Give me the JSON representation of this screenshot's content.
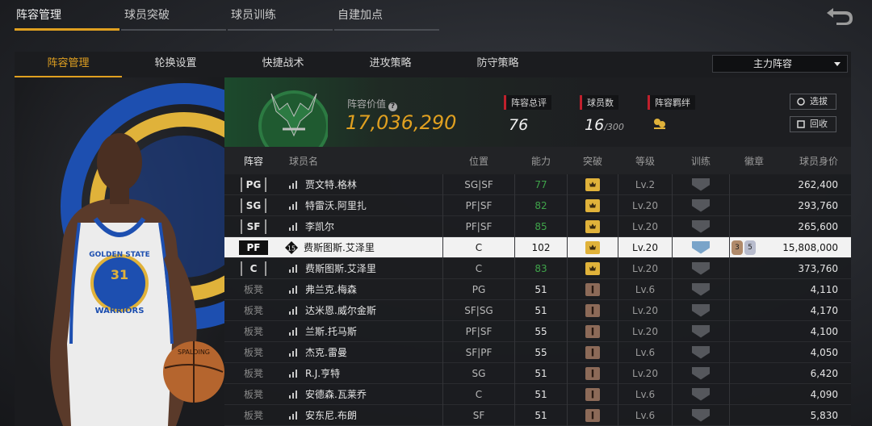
{
  "top_tabs": [
    {
      "label": "阵容管理",
      "active": true
    },
    {
      "label": "球员突破",
      "active": false
    },
    {
      "label": "球员训练",
      "active": false
    },
    {
      "label": "自建加点",
      "active": false
    }
  ],
  "sub_tabs": [
    {
      "label": "阵容管理",
      "active": true
    },
    {
      "label": "轮换设置",
      "active": false
    },
    {
      "label": "快捷战术",
      "active": false
    },
    {
      "label": "进攻策略",
      "active": false
    },
    {
      "label": "防守策略",
      "active": false
    }
  ],
  "lineup_select": {
    "value": "主力阵容"
  },
  "info": {
    "value_label": "阵容价值",
    "value": "17,036,290",
    "rating_label": "阵容总评",
    "rating": "76",
    "players_label": "球员数",
    "players": "16",
    "players_max": "/300",
    "bond_label": "阵容羁绊",
    "btn_draft": "选拔",
    "btn_recycle": "回收"
  },
  "player_art": {
    "jersey_team": "GOLDEN STATE",
    "jersey_number": "31",
    "jersey_name": "WARRIORS",
    "ball_brand": "SPALDING"
  },
  "team_logo_text": "MILWAUKEE BUCKS",
  "columns": [
    "阵容",
    "球员名",
    "位置",
    "能力",
    "突破",
    "等级",
    "训练",
    "徽章",
    "球员身价"
  ],
  "rows": [
    {
      "slot": "PG",
      "name": "贾文特.格林",
      "role": "SG|SF",
      "ability": "77",
      "ability_green": true,
      "break": "gold",
      "level": "Lv.2",
      "train": "grey",
      "badges": [],
      "value": "262,400"
    },
    {
      "slot": "SG",
      "name": "特雷沃.阿里扎",
      "role": "PF|SF",
      "ability": "82",
      "ability_green": true,
      "break": "gold",
      "level": "Lv.20",
      "train": "grey",
      "badges": [],
      "value": "293,760"
    },
    {
      "slot": "SF",
      "name": "李凯尔",
      "role": "PF|SF",
      "ability": "85",
      "ability_green": true,
      "break": "gold",
      "level": "Lv.20",
      "train": "grey",
      "badges": [],
      "value": "265,600"
    },
    {
      "slot": "PF",
      "name": "费斯图斯.艾泽里",
      "role": "C",
      "ability": "102",
      "ability_green": false,
      "break": "gold",
      "level": "Lv.20",
      "train": "blue",
      "badges": [
        "3",
        "5"
      ],
      "value": "15,808,000",
      "selected": true,
      "tier": "15"
    },
    {
      "slot": "C",
      "name": "费斯图斯.艾泽里",
      "role": "C",
      "ability": "83",
      "ability_green": true,
      "break": "gold",
      "level": "Lv.20",
      "train": "grey",
      "badges": [],
      "value": "373,760"
    },
    {
      "slot": "板凳",
      "name": "弗兰克.梅森",
      "role": "PG",
      "ability": "51",
      "ability_green": false,
      "break": "brown",
      "level": "Lv.6",
      "train": "grey",
      "badges": [],
      "value": "4,110"
    },
    {
      "slot": "板凳",
      "name": "达米恩.威尔金斯",
      "role": "SF|SG",
      "ability": "51",
      "ability_green": false,
      "break": "brown",
      "level": "Lv.20",
      "train": "grey",
      "badges": [],
      "value": "4,170"
    },
    {
      "slot": "板凳",
      "name": "兰斯.托马斯",
      "role": "PF|SF",
      "ability": "55",
      "ability_green": false,
      "break": "brown",
      "level": "Lv.20",
      "train": "grey",
      "badges": [],
      "value": "4,100"
    },
    {
      "slot": "板凳",
      "name": "杰克.雷曼",
      "role": "SF|PF",
      "ability": "55",
      "ability_green": false,
      "break": "brown",
      "level": "Lv.6",
      "train": "grey",
      "badges": [],
      "value": "4,050"
    },
    {
      "slot": "板凳",
      "name": "R.J.亨特",
      "role": "SG",
      "ability": "51",
      "ability_green": false,
      "break": "brown",
      "level": "Lv.20",
      "train": "grey",
      "badges": [],
      "value": "6,420"
    },
    {
      "slot": "板凳",
      "name": "安德森.瓦莱乔",
      "role": "C",
      "ability": "51",
      "ability_green": false,
      "break": "brown",
      "level": "Lv.6",
      "train": "grey",
      "badges": [],
      "value": "4,090"
    },
    {
      "slot": "板凳",
      "name": "安东尼.布朗",
      "role": "SF",
      "ability": "51",
      "ability_green": false,
      "break": "brown",
      "level": "Lv.6",
      "train": "grey",
      "badges": [],
      "value": "5,830"
    }
  ],
  "colors": {
    "accent": "#e0a020",
    "green": "#3fa44a",
    "selected_row": "#f2f2f2"
  }
}
